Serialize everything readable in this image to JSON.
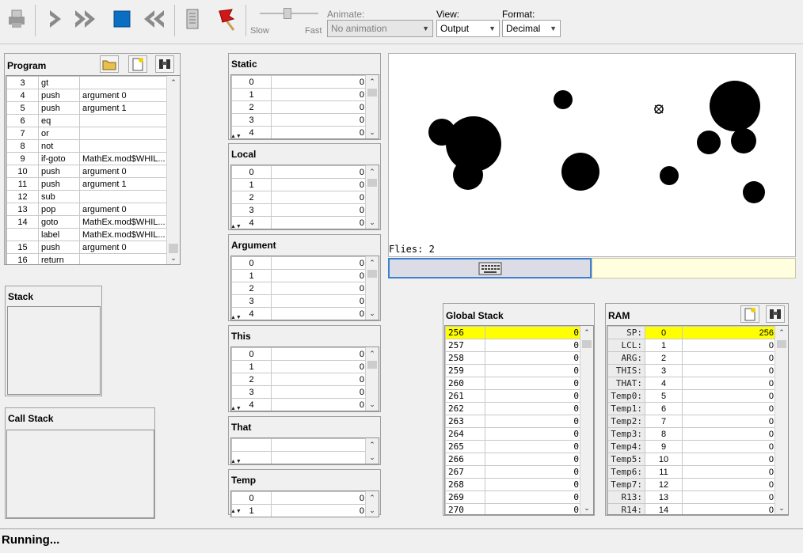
{
  "toolbar": {
    "slider_slow": "Slow",
    "slider_fast": "Fast",
    "animate_label": "Animate:",
    "animate_value": "No animation",
    "view_label": "View:",
    "view_value": "Output",
    "format_label": "Format:",
    "format_value": "Decimal"
  },
  "program": {
    "title": "Program",
    "rows": [
      {
        "n": "3",
        "cmd": "gt",
        "arg": ""
      },
      {
        "n": "4",
        "cmd": "push",
        "arg": "argument 0"
      },
      {
        "n": "5",
        "cmd": "push",
        "arg": "argument 1"
      },
      {
        "n": "6",
        "cmd": "eq",
        "arg": ""
      },
      {
        "n": "7",
        "cmd": "or",
        "arg": ""
      },
      {
        "n": "8",
        "cmd": "not",
        "arg": ""
      },
      {
        "n": "9",
        "cmd": "if-goto",
        "arg": "MathEx.mod$WHIL..."
      },
      {
        "n": "10",
        "cmd": "push",
        "arg": "argument 0"
      },
      {
        "n": "11",
        "cmd": "push",
        "arg": "argument 1"
      },
      {
        "n": "12",
        "cmd": "sub",
        "arg": ""
      },
      {
        "n": "13",
        "cmd": "pop",
        "arg": "argument 0"
      },
      {
        "n": "14",
        "cmd": "goto",
        "arg": "MathEx.mod$WHIL..."
      },
      {
        "n": "",
        "cmd": "label",
        "arg": "MathEx.mod$WHIL..."
      },
      {
        "n": "15",
        "cmd": "push",
        "arg": "argument 0"
      },
      {
        "n": "16",
        "cmd": "return",
        "arg": ""
      }
    ]
  },
  "stack": {
    "title": "Stack"
  },
  "call_stack": {
    "title": "Call Stack"
  },
  "segments": {
    "static": {
      "title": "Static",
      "rows": [
        [
          "0",
          "0"
        ],
        [
          "1",
          "0"
        ],
        [
          "2",
          "0"
        ],
        [
          "3",
          "0"
        ],
        [
          "4",
          "0"
        ]
      ]
    },
    "local": {
      "title": "Local",
      "rows": [
        [
          "0",
          "0"
        ],
        [
          "1",
          "0"
        ],
        [
          "2",
          "0"
        ],
        [
          "3",
          "0"
        ],
        [
          "4",
          "0"
        ]
      ]
    },
    "argument": {
      "title": "Argument",
      "rows": [
        [
          "0",
          "0"
        ],
        [
          "1",
          "0"
        ],
        [
          "2",
          "0"
        ],
        [
          "3",
          "0"
        ],
        [
          "4",
          "0"
        ]
      ]
    },
    "this": {
      "title": "This",
      "rows": [
        [
          "0",
          "0"
        ],
        [
          "1",
          "0"
        ],
        [
          "2",
          "0"
        ],
        [
          "3",
          "0"
        ],
        [
          "4",
          "0"
        ]
      ]
    },
    "that": {
      "title": "That",
      "rows": [
        [
          "",
          ""
        ],
        [
          "",
          ""
        ]
      ]
    },
    "temp": {
      "title": "Temp",
      "rows": [
        [
          "0",
          "0"
        ],
        [
          "1",
          "0"
        ]
      ]
    }
  },
  "screen": {
    "flies_text": "Flies: 2"
  },
  "global_stack": {
    "title": "Global Stack",
    "rows": [
      [
        "256",
        "0"
      ],
      [
        "257",
        "0"
      ],
      [
        "258",
        "0"
      ],
      [
        "259",
        "0"
      ],
      [
        "260",
        "0"
      ],
      [
        "261",
        "0"
      ],
      [
        "262",
        "0"
      ],
      [
        "263",
        "0"
      ],
      [
        "264",
        "0"
      ],
      [
        "265",
        "0"
      ],
      [
        "266",
        "0"
      ],
      [
        "267",
        "0"
      ],
      [
        "268",
        "0"
      ],
      [
        "269",
        "0"
      ],
      [
        "270",
        "0"
      ]
    ]
  },
  "ram": {
    "title": "RAM",
    "rows": [
      [
        "SP:",
        "0",
        "256"
      ],
      [
        "LCL:",
        "1",
        "0"
      ],
      [
        "ARG:",
        "2",
        "0"
      ],
      [
        "THIS:",
        "3",
        "0"
      ],
      [
        "THAT:",
        "4",
        "0"
      ],
      [
        "Temp0:",
        "5",
        "0"
      ],
      [
        "Temp1:",
        "6",
        "0"
      ],
      [
        "Temp2:",
        "7",
        "0"
      ],
      [
        "Temp3:",
        "8",
        "0"
      ],
      [
        "Temp4:",
        "9",
        "0"
      ],
      [
        "Temp5:",
        "10",
        "0"
      ],
      [
        "Temp6:",
        "11",
        "0"
      ],
      [
        "Temp7:",
        "12",
        "0"
      ],
      [
        "R13:",
        "13",
        "0"
      ],
      [
        "R14:",
        "14",
        "0"
      ]
    ]
  },
  "status": {
    "text": "Running..."
  },
  "colors": {
    "highlight": "#ffff00",
    "selection_border": "#3c7fd0",
    "keyboard_bg": "#ffffe0"
  }
}
